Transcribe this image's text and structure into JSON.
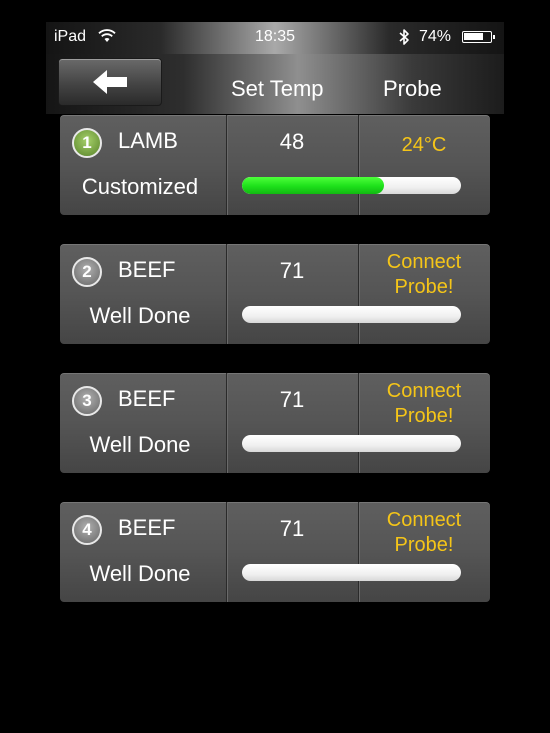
{
  "status_bar": {
    "carrier": "iPad",
    "time": "18:35",
    "battery_percent_label": "74%",
    "battery_level": 0.74,
    "wifi_icon": "wifi-icon",
    "bluetooth_icon": "bluetooth-icon"
  },
  "nav": {
    "back_icon": "arrow-left-icon",
    "col_set_temp": "Set Temp",
    "col_probe": "Probe"
  },
  "colors": {
    "probe_text": "#f5c518",
    "progress_green": "#1de01a",
    "badge_active": "#6f9a3c",
    "badge_inactive": "#7c7c7c"
  },
  "probes": [
    {
      "number": "1",
      "meat": "LAMB",
      "doneness": "Customized",
      "set_temp": "48",
      "probe_line1": "24°C",
      "probe_line2": "",
      "progress": 0.65,
      "active": true
    },
    {
      "number": "2",
      "meat": "BEEF",
      "doneness": "Well Done",
      "set_temp": "71",
      "probe_line1": "Connect",
      "probe_line2": "Probe!",
      "progress": 0,
      "active": false
    },
    {
      "number": "3",
      "meat": "BEEF",
      "doneness": "Well Done",
      "set_temp": "71",
      "probe_line1": "Connect",
      "probe_line2": "Probe!",
      "progress": 0,
      "active": false
    },
    {
      "number": "4",
      "meat": "BEEF",
      "doneness": "Well Done",
      "set_temp": "71",
      "probe_line1": "Connect",
      "probe_line2": "Probe!",
      "progress": 0,
      "active": false
    }
  ]
}
